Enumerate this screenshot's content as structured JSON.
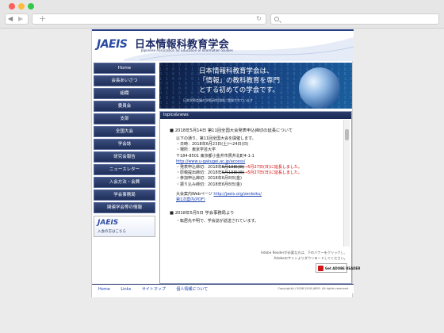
{
  "browser": {
    "back_glyph": "◀",
    "forward_glyph": "▶",
    "new_tab_glyph": "+",
    "reload_glyph": "↻"
  },
  "header": {
    "logo": "JAEIS",
    "title": "日本情報科教育学会",
    "subtitle": "Japanese Association for Education of Information Studies"
  },
  "sidebar": {
    "items": [
      {
        "label": "Home"
      },
      {
        "label": "会長あいさつ"
      },
      {
        "label": "組織"
      },
      {
        "label": "委員会"
      },
      {
        "label": "支部"
      },
      {
        "label": "全国大会"
      },
      {
        "label": "学会誌"
      },
      {
        "label": "研究会報告"
      },
      {
        "label": "ニュースレター"
      },
      {
        "label": "入会方法・会費"
      },
      {
        "label": "学会事務局"
      },
      {
        "label": "関連学会等の情報"
      }
    ],
    "banner_logo": "JAEIS",
    "banner_text": "入会の方はこちら"
  },
  "hero": {
    "line1": "日本情報科教育学会は、",
    "line2": "「情報」の教科教育を専門",
    "line3": "とする初めての学会です。",
    "note": "日本学術会議の学術研究団体に登録されています"
  },
  "news": {
    "tab_label": "topics&news",
    "item1_heading": "■ 2018年5月14日 第11回全国大会発表申込締切の延長について",
    "item1_intro": "以下の通り、第11回全国大会を開催します。",
    "item1_date": "・日時：2018年6月23日(土)〜24日(日)",
    "item1_venue": "・場所：東京学芸大学",
    "item1_address": "〒184-8501 東京都小金井市貫井北町4-1-1",
    "item1_url": "http://www.u-gakugei.ac.jp/access/",
    "item1_deadline1_prefix": "・発表申込締切：2018年",
    "item1_deadline1_old": "5月13日(日)",
    "item1_deadline1_new": "→5月27日(日)に延長しました。",
    "item1_deadline2_prefix": "・原稿提出締切：2018年",
    "item1_deadline2_old": "5月13日(日)",
    "item1_deadline2_new": "→5月27日(日)に延長しました。",
    "item1_deadline3": "・参加申込締切：2018年6月8日(金)",
    "item1_deadline4": "・振り込み締切：2018年6月8日(金)",
    "item1_web_label": "大会案内Webページ",
    "item1_web_url": "http://jaeis.org/zenkoku/",
    "item1_pdf": "第1次案内(PDF)",
    "item2_heading": "■ 2018年5月5日 学会事務局より",
    "item2_line": "・転居先不明で、学会誌が返送されています。",
    "adobe_text1": "Adobe Readerが必要な方は、下のバナーをクリックし、",
    "adobe_text2": "Adobeのサイトよりダウンロードしてください。",
    "adobe_label": "Get ADOBE READER"
  },
  "footer": {
    "links": [
      "Home",
      "Links",
      "サイトマップ",
      "個人情報について"
    ],
    "copyright": "Copyright(c) 2008-2018 JAEIS. All rights reserved."
  }
}
